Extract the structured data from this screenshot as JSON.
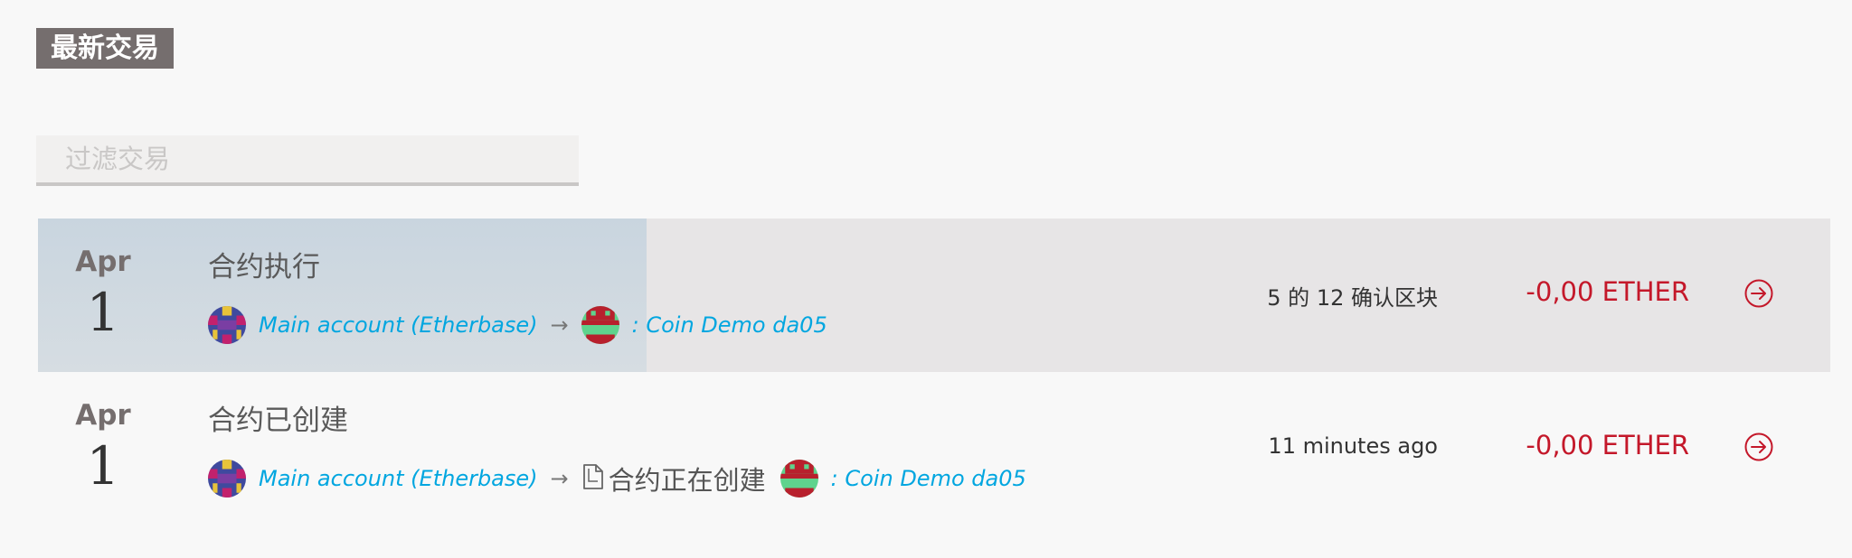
{
  "header": {
    "title": "最新交易"
  },
  "filter": {
    "placeholder": "过滤交易"
  },
  "transactions": [
    {
      "month": "Apr",
      "day": "1",
      "title": "合约执行",
      "from": "Main account (Etherbase)",
      "arrow": "→",
      "to": ": Coin Demo da05",
      "status_num": "5",
      "status_of": " 的 ",
      "status_total": "12",
      "status_suffix": " 确认区块",
      "amount": "-0,00 ETHER",
      "progress": 0.41
    },
    {
      "month": "Apr",
      "day": "1",
      "title": "合约已创建",
      "from": "Main account (Etherbase)",
      "arrow": "→",
      "creating": "合约正在创建",
      "to": ": Coin Demo da05",
      "status": "11 minutes ago",
      "amount": "-0,00 ETHER"
    }
  ],
  "colors": {
    "accent": "#00a6e0",
    "amount": "#c4182a",
    "header_bg": "#756e6e"
  },
  "icons": [
    "account-identicon",
    "contract-identicon",
    "document-icon",
    "arrow-circle-right-icon"
  ]
}
